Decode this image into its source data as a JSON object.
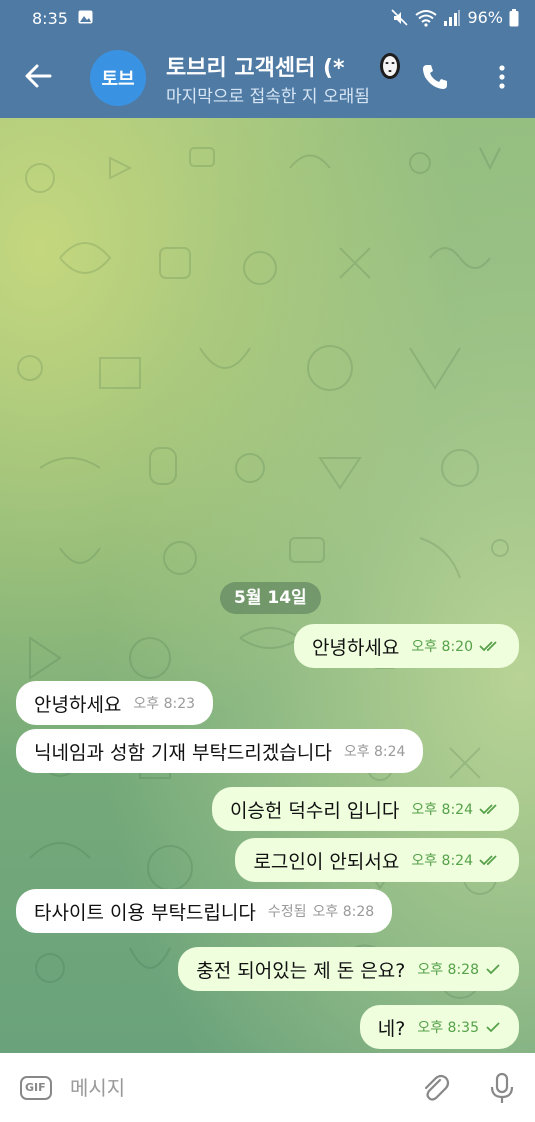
{
  "status_bar": {
    "time": "8:35",
    "battery": "96%",
    "icons": [
      "image-icon",
      "mute-icon",
      "wifi-icon",
      "signal-icon",
      "battery-icon"
    ]
  },
  "header": {
    "back_icon": "arrow-left-icon",
    "avatar_text": "토브",
    "title": "토브리 고객센터 (*",
    "subtitle": "마지막으로 접속한 지 오래됨",
    "call_icon": "phone-icon",
    "more_icon": "more-vertical-icon"
  },
  "chat": {
    "date": "5월 14일",
    "messages": [
      {
        "dir": "out",
        "text": "안녕하세요",
        "time": "오후 8:20",
        "status": "read"
      },
      {
        "dir": "in",
        "text": "안녕하세요",
        "time": "오후 8:23"
      },
      {
        "dir": "in",
        "text": "닉네임과 성함 기재 부탁드리겠습니다",
        "time": "오후 8:24"
      },
      {
        "dir": "out",
        "text": "이승헌 덕수리 입니다",
        "time": "오후 8:24",
        "status": "read"
      },
      {
        "dir": "out",
        "text": "로그인이 안되서요",
        "time": "오후 8:24",
        "status": "read"
      },
      {
        "dir": "in",
        "text": "타사이트 이용 부탁드립니다",
        "edited": "수정됨",
        "time": "오후 8:28"
      },
      {
        "dir": "out",
        "text": "충전 되어있는 제 돈 은요?",
        "time": "오후 8:28",
        "status": "sent"
      },
      {
        "dir": "out",
        "text": "네?",
        "time": "오후 8:35",
        "status": "sent"
      }
    ]
  },
  "input": {
    "gif_label": "GIF",
    "placeholder": "메시지",
    "attach_icon": "paperclip-icon",
    "mic_icon": "microphone-icon"
  },
  "colors": {
    "header": "#4e7aa4",
    "outgoing_bubble": "#effedd",
    "incoming_bubble": "#ffffff",
    "check": "#56a14a",
    "avatar": "#3a93e2"
  }
}
